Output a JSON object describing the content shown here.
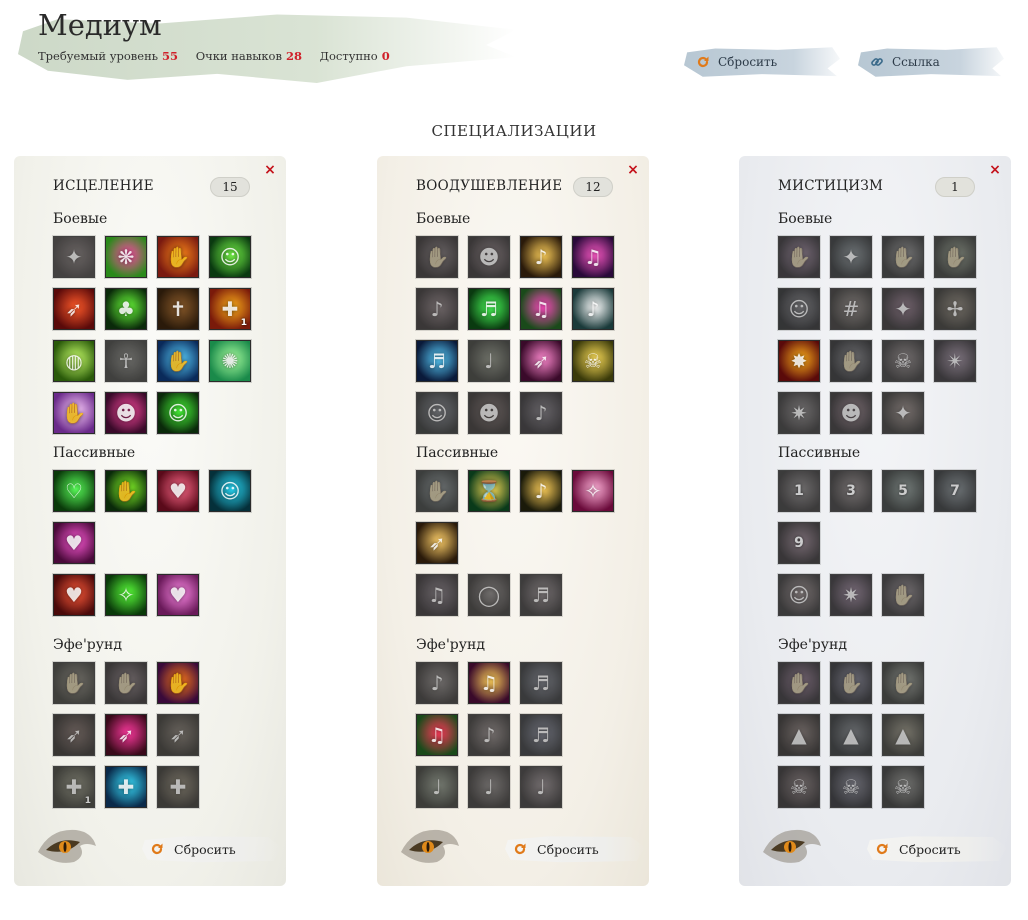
{
  "header": {
    "title": "Медиум",
    "required_level_label": "Требуемый уровень",
    "required_level": "55",
    "skill_points_label": "Очки навыков",
    "skill_points": "28",
    "available_label": "Доступно",
    "available": "0"
  },
  "toolbar": {
    "reset_label": "Сбросить",
    "link_label": "Ссылка"
  },
  "specializations_heading": "СПЕЦИАЛИЗАЦИИ",
  "panels": [
    {
      "name": "ИСЦЕЛЕНИЕ",
      "points": "15",
      "sections": {
        "combat": "Боевые",
        "passive": "Пассивные",
        "ephereund": "Эфе'рунд"
      },
      "reset_label": "Сбросить",
      "combat": [
        {
          "active": false,
          "c1": "#7a5a5a",
          "c2": "#3a2a2a",
          "glyph": "✦"
        },
        {
          "active": true,
          "c1": "#ff4aa8",
          "c2": "#2a8a1a",
          "glyph": "❋"
        },
        {
          "active": true,
          "c1": "#ff8a1a",
          "c2": "#7a1a10",
          "glyph": "✋"
        },
        {
          "active": true,
          "c1": "#7aff4a",
          "c2": "#0a3a10",
          "glyph": "☺"
        },
        {
          "active": true,
          "c1": "#ff5a2a",
          "c2": "#5a0a0a",
          "glyph": "➶"
        },
        {
          "active": true,
          "c1": "#6aff3a",
          "c2": "#0a2a0a",
          "glyph": "♣"
        },
        {
          "active": true,
          "c1": "#8a5a2a",
          "c2": "#2a1a0a",
          "glyph": "✝"
        },
        {
          "active": true,
          "c1": "#ffb01a",
          "c2": "#7a1a0a",
          "glyph": "✚",
          "corner": "1"
        },
        {
          "active": true,
          "c1": "#c8ff6a",
          "c2": "#2a5a0a",
          "glyph": "◍"
        },
        {
          "active": false,
          "c1": "#6a6a5a",
          "c2": "#2a2a22",
          "glyph": "☥"
        },
        {
          "active": true,
          "c1": "#5ad0ff",
          "c2": "#0a2a5a",
          "glyph": "✋"
        },
        {
          "active": true,
          "c1": "#aaffa0",
          "c2": "#1a8a4a",
          "glyph": "✺"
        },
        {
          "active": true,
          "c1": "#ffd0ff",
          "c2": "#6a2a8a",
          "glyph": "✋"
        },
        {
          "active": true,
          "c1": "#ff4aa0",
          "c2": "#3a0a2a",
          "glyph": "☻"
        },
        {
          "active": true,
          "c1": "#4aff3a",
          "c2": "#0a2a0a",
          "glyph": "☺"
        }
      ],
      "passive": [
        {
          "active": true,
          "c1": "#5aff5a",
          "c2": "#0a3a0a",
          "glyph": "♡"
        },
        {
          "active": true,
          "c1": "#8aff2a",
          "c2": "#0a2a0a",
          "glyph": "✋"
        },
        {
          "active": true,
          "c1": "#ff6a8a",
          "c2": "#5a0a1a",
          "glyph": "♥"
        },
        {
          "active": true,
          "c1": "#2ae0ff",
          "c2": "#05303a",
          "glyph": "☺"
        },
        {
          "active": true,
          "c1": "#ff5ad8",
          "c2": "#4a0a3a",
          "glyph": "♥"
        },
        {
          "active": true,
          "c1": "#ff5a3a",
          "c2": "#4a0a0a",
          "glyph": "♥"
        },
        {
          "active": true,
          "c1": "#5aff3a",
          "c2": "#0a3a0a",
          "glyph": "✧"
        },
        {
          "active": true,
          "c1": "#ff8ae8",
          "c2": "#6a1a5a",
          "glyph": "♥"
        }
      ],
      "ephereund": [
        {
          "active": false,
          "c1": "#7a6a4a",
          "c2": "#2a2a1a",
          "glyph": "✋"
        },
        {
          "active": false,
          "c1": "#8a5a6a",
          "c2": "#2a1a22",
          "glyph": "✋"
        },
        {
          "active": true,
          "c1": "#ff7a1a",
          "c2": "#3a0a3a",
          "glyph": "✋"
        },
        {
          "active": false,
          "c1": "#8a4a3a",
          "c2": "#2a1a12",
          "glyph": "➶"
        },
        {
          "active": true,
          "c1": "#ff3aa0",
          "c2": "#3a0a1a",
          "glyph": "➶"
        },
        {
          "active": false,
          "c1": "#7a5a3a",
          "c2": "#2a2012",
          "glyph": "➶"
        },
        {
          "active": false,
          "c1": "#7a7a3a",
          "c2": "#2a2a12",
          "glyph": "✚",
          "corner": "1"
        },
        {
          "active": true,
          "c1": "#3ae0ff",
          "c2": "#0a2a4a",
          "glyph": "✚"
        },
        {
          "active": false,
          "c1": "#8a6a2a",
          "c2": "#2a2012",
          "glyph": "✚"
        }
      ]
    },
    {
      "name": "ВООДУШЕВЛЕНИЕ",
      "points": "12",
      "sections": {
        "combat": "Боевые",
        "passive": "Пассивные",
        "ephereund": "Эфе'рунд"
      },
      "reset_label": "Сбросить",
      "combat": [
        {
          "active": false,
          "c1": "#7a5a6a",
          "c2": "#2a1a22",
          "glyph": "✋"
        },
        {
          "active": false,
          "c1": "#8a5a6a",
          "c2": "#2a1a22",
          "glyph": "☻"
        },
        {
          "active": true,
          "c1": "#ffd05a",
          "c2": "#2a1a0a",
          "glyph": "♪"
        },
        {
          "active": true,
          "c1": "#ff5ac8",
          "c2": "#2a0a3a",
          "glyph": "♫"
        },
        {
          "active": false,
          "c1": "#8a5a6a",
          "c2": "#2a1a22",
          "glyph": "♪"
        },
        {
          "active": true,
          "c1": "#4aff5a",
          "c2": "#0a3a10",
          "glyph": "♬"
        },
        {
          "active": true,
          "c1": "#ff4ac0",
          "c2": "#1a4a1a",
          "glyph": "♫"
        },
        {
          "active": true,
          "c1": "#ffffff",
          "c2": "#1a3a3a",
          "glyph": "♪"
        },
        {
          "active": true,
          "c1": "#5ad0ff",
          "c2": "#0a1a3a",
          "glyph": "♬"
        },
        {
          "active": false,
          "c1": "#6a7a4a",
          "c2": "#22281a",
          "glyph": "♩"
        },
        {
          "active": true,
          "c1": "#ff8ad0",
          "c2": "#3a0a2a",
          "glyph": "➶"
        },
        {
          "active": true,
          "c1": "#ffe05a",
          "c2": "#3a3a0a",
          "glyph": "☠"
        },
        {
          "active": false,
          "c1": "#5a6a8a",
          "c2": "#1a222a",
          "glyph": "☺"
        },
        {
          "active": false,
          "c1": "#7a4a4a",
          "c2": "#2a1a1a",
          "glyph": "☻"
        },
        {
          "active": false,
          "c1": "#6a5a7a",
          "c2": "#221a2a",
          "glyph": "♪"
        }
      ],
      "passive": [
        {
          "active": false,
          "c1": "#5a7a8a",
          "c2": "#1a2a2a",
          "glyph": "✋"
        },
        {
          "active": true,
          "c1": "#ffe05a",
          "c2": "#0a3a1a",
          "glyph": "⌛"
        },
        {
          "active": true,
          "c1": "#ffd05a",
          "c2": "#1a1a0a",
          "glyph": "♪"
        },
        {
          "active": true,
          "c1": "#ffb0d8",
          "c2": "#6a0a3a",
          "glyph": "✧"
        },
        {
          "active": true,
          "c1": "#ffd06a",
          "c2": "#2a1a0a",
          "glyph": "➶"
        },
        {
          "active": false,
          "c1": "#7a5a7a",
          "c2": "#2a1a2a",
          "glyph": "♫"
        },
        {
          "active": false,
          "c1": "#7a6a6a",
          "c2": "#2a2222",
          "glyph": "◯"
        },
        {
          "active": false,
          "c1": "#8a6a7a",
          "c2": "#2a2228",
          "glyph": "♬"
        }
      ],
      "ephereund": [
        {
          "active": false,
          "c1": "#7a6a6a",
          "c2": "#2a2222",
          "glyph": "♪"
        },
        {
          "active": true,
          "c1": "#ffd05a",
          "c2": "#3a0a2a",
          "glyph": "♫"
        },
        {
          "active": false,
          "c1": "#5a6a9a",
          "c2": "#1a2232",
          "glyph": "♬"
        },
        {
          "active": true,
          "c1": "#ff3a5a",
          "c2": "#1a4a1a",
          "glyph": "♫"
        },
        {
          "active": false,
          "c1": "#8a6a6a",
          "c2": "#2a2222",
          "glyph": "♪"
        },
        {
          "active": false,
          "c1": "#5a6aaa",
          "c2": "#1a2234",
          "glyph": "♬"
        },
        {
          "active": false,
          "c1": "#6a8a5a",
          "c2": "#222a1a",
          "glyph": "♩"
        },
        {
          "active": false,
          "c1": "#7a6a6a",
          "c2": "#2a2222",
          "glyph": "♩"
        },
        {
          "active": false,
          "c1": "#8a6a7a",
          "c2": "#2a2228",
          "glyph": "♩"
        }
      ]
    },
    {
      "name": "МИСТИЦИЗМ",
      "points": "1",
      "sections": {
        "combat": "Боевые",
        "passive": "Пассивные",
        "ephereund": "Эфе'рунд"
      },
      "reset_label": "Сбросить",
      "combat": [
        {
          "active": false,
          "c1": "#aa5aaa",
          "c2": "#2a1a2a",
          "glyph": "✋"
        },
        {
          "active": false,
          "c1": "#5a7a8a",
          "c2": "#1a2228",
          "glyph": "✦"
        },
        {
          "active": false,
          "c1": "#7a7a7a",
          "c2": "#222222",
          "glyph": "✋"
        },
        {
          "active": false,
          "c1": "#6a8a4a",
          "c2": "#22281a",
          "glyph": "✋"
        },
        {
          "active": false,
          "c1": "#6a6a7a",
          "c2": "#1a1a22",
          "glyph": "☺"
        },
        {
          "active": false,
          "c1": "#8a6a5a",
          "c2": "#2a221a",
          "glyph": "#"
        },
        {
          "active": false,
          "c1": "#aa4a8a",
          "c2": "#2a1a22",
          "glyph": "✦"
        },
        {
          "active": false,
          "c1": "#8a6a3a",
          "c2": "#2a2212",
          "glyph": "✢"
        },
        {
          "active": true,
          "c1": "#ffb01a",
          "c2": "#5a0a0a",
          "glyph": "✸"
        },
        {
          "active": false,
          "c1": "#6a6a7a",
          "c2": "#1a1a22",
          "glyph": "✋"
        },
        {
          "active": false,
          "c1": "#8a6a6a",
          "c2": "#2a2222",
          "glyph": "☠"
        },
        {
          "active": false,
          "c1": "#aa6aaa",
          "c2": "#2a1a2a",
          "glyph": "✴"
        },
        {
          "active": false,
          "c1": "#7a6a6a",
          "c2": "#2a2222",
          "glyph": "✷"
        },
        {
          "active": false,
          "c1": "#aa5a7a",
          "c2": "#2a1a22",
          "glyph": "☻"
        },
        {
          "active": false,
          "c1": "#9a6a5a",
          "c2": "#2a221a",
          "glyph": "✦"
        }
      ],
      "passive": [
        {
          "active": false,
          "c1": "#7a6a6a",
          "c2": "#2a2222",
          "glyph": "",
          "rank": "1"
        },
        {
          "active": false,
          "c1": "#8a6a6a",
          "c2": "#2a2222",
          "glyph": "",
          "rank": "3"
        },
        {
          "active": false,
          "c1": "#5a8a7a",
          "c2": "#1a2a22",
          "glyph": "",
          "rank": "5"
        },
        {
          "active": false,
          "c1": "#5a7a8a",
          "c2": "#1a2228",
          "glyph": "",
          "rank": "7"
        },
        {
          "active": false,
          "c1": "#aa5a8a",
          "c2": "#2a1a22",
          "glyph": "",
          "rank": "9"
        },
        {
          "active": false,
          "c1": "#9a6a6a",
          "c2": "#2a2222",
          "glyph": "☺"
        },
        {
          "active": false,
          "c1": "#aa5aaa",
          "c2": "#2a1a2a",
          "glyph": "✷"
        },
        {
          "active": false,
          "c1": "#8a6a7a",
          "c2": "#2a2228",
          "glyph": "✋"
        }
      ],
      "ephereund": [
        {
          "active": false,
          "c1": "#aa4a9a",
          "c2": "#2a1a2a",
          "glyph": "✋"
        },
        {
          "active": false,
          "c1": "#6a6aaa",
          "c2": "#1a1a2a",
          "glyph": "✋"
        },
        {
          "active": false,
          "c1": "#7a8a6a",
          "c2": "#22281a",
          "glyph": "✋"
        },
        {
          "active": false,
          "c1": "#8a5a4a",
          "c2": "#2a1a12",
          "glyph": "▲"
        },
        {
          "active": false,
          "c1": "#5a6a7a",
          "c2": "#1a2228",
          "glyph": "▲"
        },
        {
          "active": false,
          "c1": "#8a7a3a",
          "c2": "#2a2812",
          "glyph": "▲"
        },
        {
          "active": false,
          "c1": "#8a5a5a",
          "c2": "#2a1a1a",
          "glyph": "☠"
        },
        {
          "active": false,
          "c1": "#6a6a9a",
          "c2": "#1a1a2a",
          "glyph": "☠"
        },
        {
          "active": false,
          "c1": "#7a7a6a",
          "c2": "#22221a",
          "glyph": "☠"
        }
      ]
    }
  ]
}
